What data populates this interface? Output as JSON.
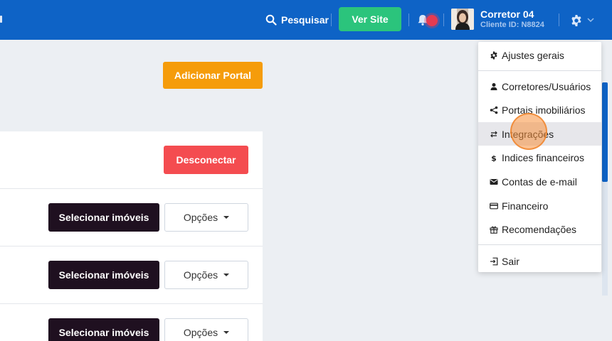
{
  "topbar": {
    "search_label": "Pesquisar",
    "site_button": "Ver Site",
    "user": {
      "name": "Corretor 04",
      "client_id": "Cliente ID: N8824"
    }
  },
  "actions": {
    "add_portal": "Adicionar Portal",
    "disconnect": "Desconectar"
  },
  "rows": [
    {
      "select_label": "Selecionar imóveis",
      "options_label": "Opções"
    },
    {
      "select_label": "Selecionar imóveis",
      "options_label": "Opções"
    },
    {
      "select_label": "Selecionar imóveis",
      "options_label": "Opções"
    }
  ],
  "menu": {
    "items": [
      {
        "label": "Ajustes gerais",
        "icon": "gear-icon"
      },
      {
        "label": "Corretores/Usuários",
        "icon": "user-icon"
      },
      {
        "label": "Portais imobiliários",
        "icon": "share-icon"
      },
      {
        "label": "Integrações",
        "icon": "swap-icon",
        "active": true
      },
      {
        "label": "Indices financeiros",
        "icon": "dollar-icon"
      },
      {
        "label": "Contas de e-mail",
        "icon": "envelope-icon"
      },
      {
        "label": "Financeiro",
        "icon": "credit-card-icon"
      },
      {
        "label": "Recomendações",
        "icon": "gift-icon"
      },
      {
        "label": "Sair",
        "icon": "sign-out-icon"
      }
    ]
  },
  "colors": {
    "topbar": "#0e63c6",
    "site_button": "#2bc47c",
    "add_portal": "#f59c0b",
    "disconnect": "#f44c50",
    "select_button": "#1f1020"
  }
}
